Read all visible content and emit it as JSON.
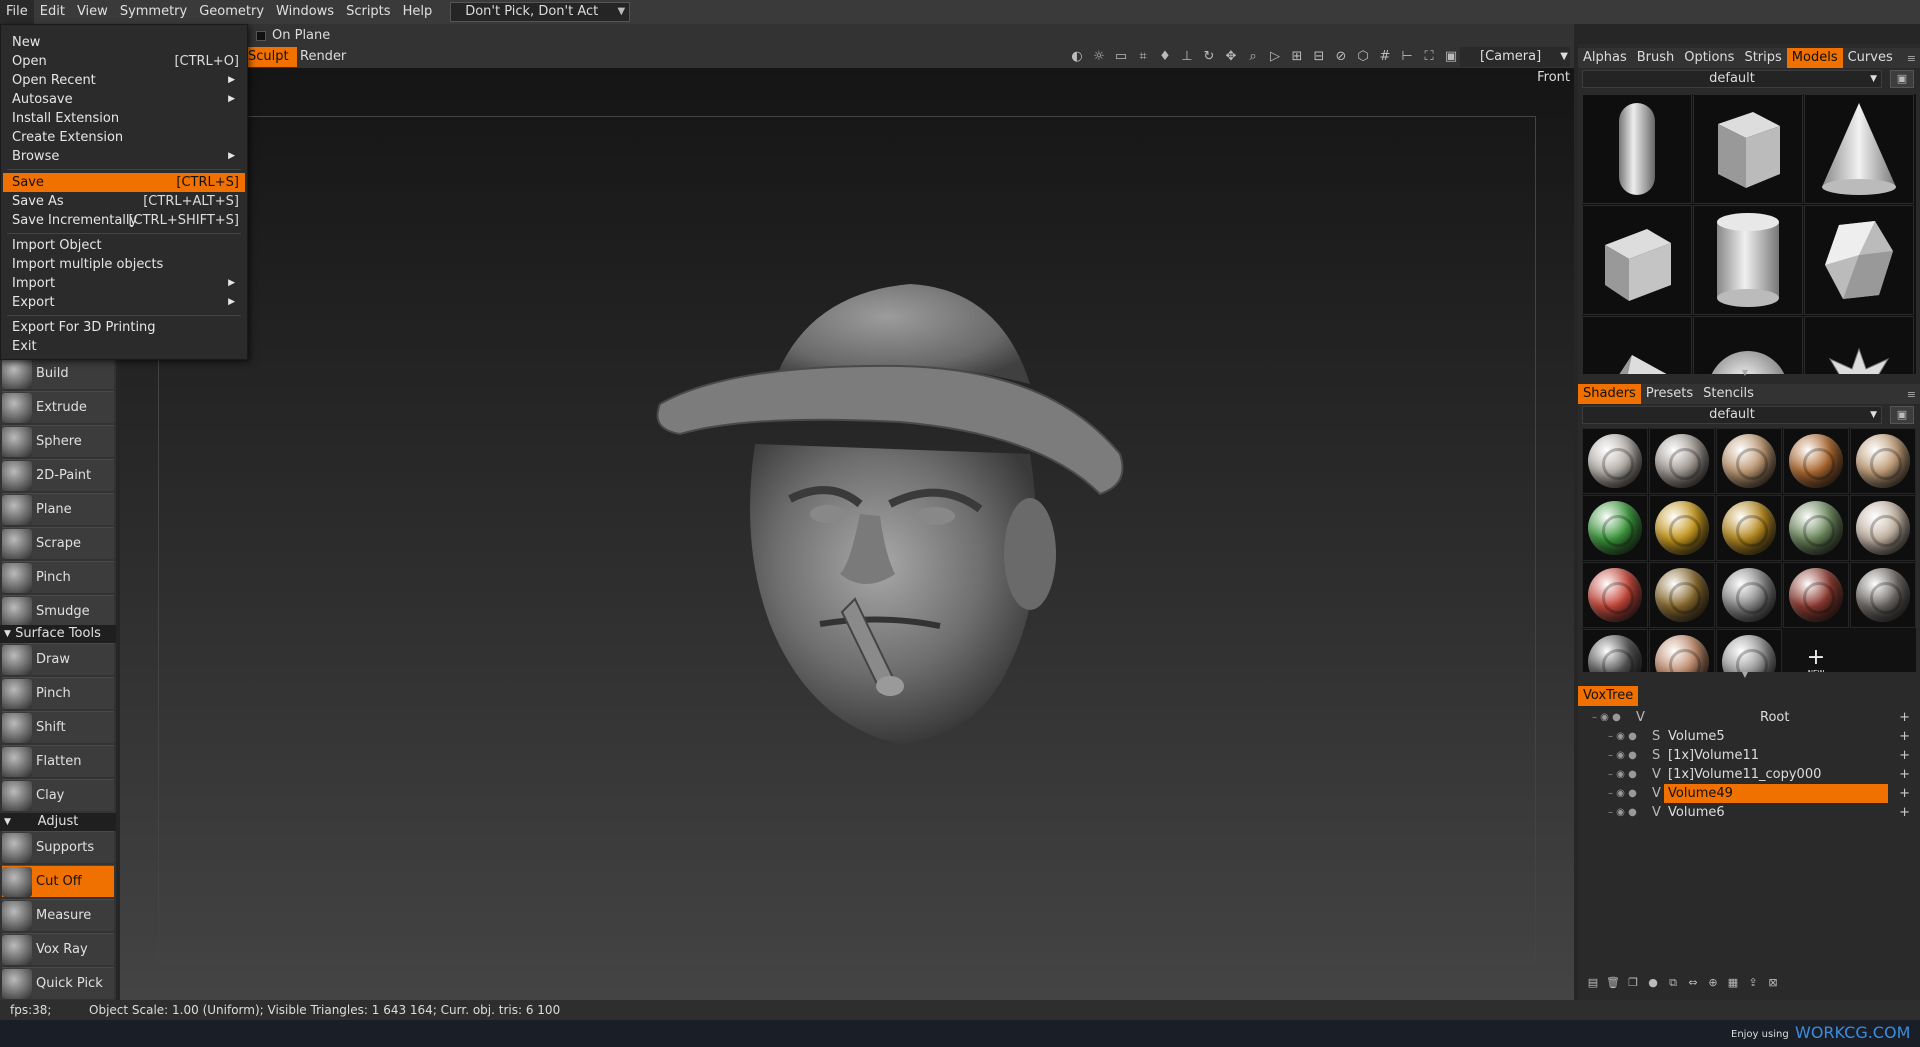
{
  "menubar": {
    "items": [
      "File",
      "Edit",
      "View",
      "Symmetry",
      "Geometry",
      "Windows",
      "Scripts",
      "Help"
    ],
    "pick_mode": "Don't Pick, Don't Act"
  },
  "toolbar": {
    "on_plane": "On Plane",
    "tab_sculpt": "Sculpt",
    "tab_render": "Render",
    "camera": "[Camera]"
  },
  "viewport": {
    "view_label": "Front"
  },
  "file_menu": {
    "new": "New",
    "open": "Open",
    "open_sc": "[CTRL+O]",
    "open_recent": "Open  Recent",
    "autosave": "Autosave",
    "install_ext": "Install  Extension",
    "create_ext": "Create  Extension",
    "browse": "Browse",
    "save": "Save",
    "save_sc": "[CTRL+S]",
    "save_as": "Save  As",
    "save_as_sc": "[CTRL+ALT+S]",
    "save_inc": "Save  Incrementally",
    "save_inc_sc": "[CTRL+SHIFT+S]",
    "import_obj": "Import  Object",
    "import_multi": "Import  multiple  objects",
    "import": "Import",
    "export": "Export",
    "export_3d": "Export  For  3D  Printing",
    "exit": "Exit"
  },
  "tools": {
    "build": "Build",
    "extrude": "Extrude",
    "sphere": "Sphere",
    "paint2d": "2D-Paint",
    "plane": "Plane",
    "scrape": "Scrape",
    "pinch": "Pinch",
    "smudge": "Smudge",
    "surface_section": "Surface  Tools",
    "draw": "Draw",
    "pinch2": "Pinch",
    "shift": "Shift",
    "flatten": "Flatten",
    "clay": "Clay",
    "adjust_section": "Adjust",
    "supports": "Supports",
    "cutoff": "Cut  Off",
    "measure": "Measure",
    "voxray": "Vox  Ray",
    "quickpick": "Quick  Pick"
  },
  "top_tabs": [
    "Alphas",
    "Brush",
    "Options",
    "Strips",
    "Models",
    "Curves"
  ],
  "models_preset": "default",
  "shader_tabs": [
    "Shaders",
    "Presets",
    "Stencils"
  ],
  "shaders_preset": "default",
  "new_shader_label": "NEW",
  "shader_colors": [
    "#b9b3ae",
    "#a49c95",
    "#c09a74",
    "#b06a30",
    "#c4a07a",
    "#3c9a3c",
    "#c89a1e",
    "#b88a1e",
    "#6e8a5e",
    "#c8b8a8",
    "#c8473a",
    "#8a6a2e",
    "#8a8a8a",
    "#8e3a30",
    "#6e6a66",
    "#555555",
    "#c08a6a",
    "#9a9a9a"
  ],
  "voxtree": {
    "tab": "VoxTree",
    "rows": [
      {
        "type": "V",
        "name": "Root"
      },
      {
        "type": "S",
        "name": "Volume5"
      },
      {
        "type": "S",
        "name": "[1x]Volume11"
      },
      {
        "type": "V",
        "name": "[1x]Volume11_copy000"
      },
      {
        "type": "V",
        "name": "Volume49"
      },
      {
        "type": "V",
        "name": "Volume6"
      }
    ]
  },
  "status": {
    "fps": "fps:38;",
    "info": "Object  Scale:  1.00  (Uniform);  Visible  Triangles:  1 643  164;  Curr.  obj.  tris:  6  100"
  },
  "footer": {
    "enjoy": "Enjoy using",
    "brand": "WORKCG.COM"
  },
  "colors": {
    "accent": "#f07000",
    "bg": "#262626",
    "panel": "#333333"
  }
}
